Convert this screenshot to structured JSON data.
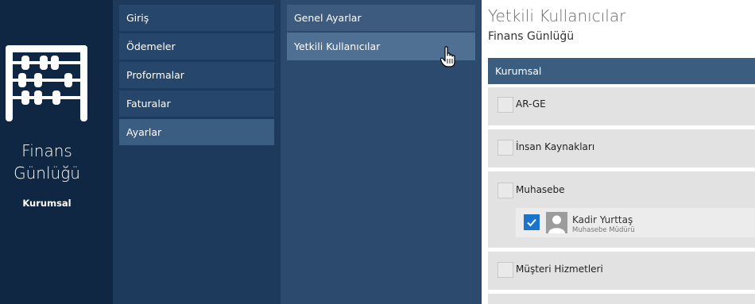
{
  "brand": {
    "logo_icon": "abacus-icon",
    "title_line1": "Finans",
    "title_line2": "Günlüğü",
    "subtitle": "Kurumsal"
  },
  "main_menu": {
    "items": [
      {
        "label": "Giriş"
      },
      {
        "label": "Ödemeler"
      },
      {
        "label": "Proformalar"
      },
      {
        "label": "Faturalar"
      },
      {
        "label": "Ayarlar",
        "active": true
      }
    ]
  },
  "sub_menu": {
    "items": [
      {
        "label": "Genel Ayarlar"
      },
      {
        "label": "Yetkili Kullanıcılar",
        "active": true
      }
    ]
  },
  "content": {
    "title": "Yetkili Kullanıcılar",
    "subtitle": "Finans Günlüğü",
    "group_header": "Kurumsal",
    "departments": [
      {
        "label": "AR-GE",
        "checked": false
      },
      {
        "label": "İnsan Kaynakları",
        "checked": false
      },
      {
        "label": "Muhasebe",
        "checked": false
      },
      {
        "label": "Müşteri Hizmetleri",
        "checked": false
      }
    ],
    "user": {
      "name": "Kadir Yurttaş",
      "role": "Muhasebe Müdürü",
      "checked": true
    }
  },
  "colors": {
    "brand_bg": "#0f2742",
    "main_menu_bg": "#1d3a5c",
    "sub_menu_bg": "#2c4a6d",
    "active_item": "#3b5d82",
    "checkbox_checked": "#1b74c9"
  }
}
